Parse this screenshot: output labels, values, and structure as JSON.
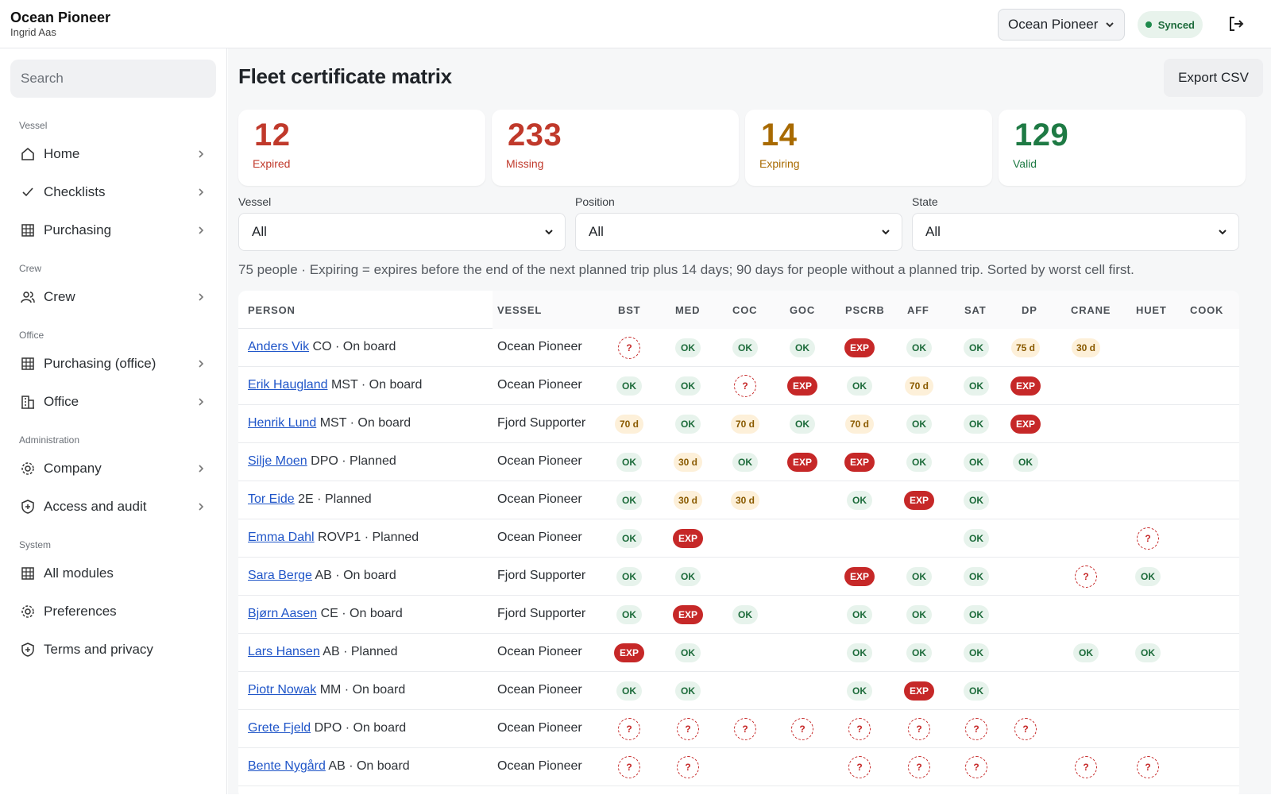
{
  "header": {
    "app_title": "Ocean Pioneer",
    "user_name": "Ingrid Aas",
    "vessel_selector": "Ocean Pioneer",
    "sync_status": "Synced",
    "colors": {
      "sync": "#1f8a4c"
    }
  },
  "sidebar": {
    "search_placeholder": "Search",
    "sections": [
      {
        "label": "Vessel",
        "items": [
          {
            "label": "Home",
            "icon": "home-icon"
          },
          {
            "label": "Checklists",
            "icon": "check-icon"
          },
          {
            "label": "Purchasing",
            "icon": "grid-icon"
          }
        ]
      },
      {
        "label": "Crew",
        "items": [
          {
            "label": "Crew",
            "icon": "people-icon"
          }
        ]
      },
      {
        "label": "Office",
        "items": [
          {
            "label": "Purchasing (office)",
            "icon": "grid-icon"
          },
          {
            "label": "Office",
            "icon": "building-icon"
          }
        ]
      },
      {
        "label": "Administration",
        "items": [
          {
            "label": "Company",
            "icon": "gear-icon"
          },
          {
            "label": "Access and audit",
            "icon": "shield-icon"
          }
        ]
      },
      {
        "label": "System",
        "items": [
          {
            "label": "All modules",
            "icon": "grid-icon"
          },
          {
            "label": "Preferences",
            "icon": "gear-icon"
          },
          {
            "label": "Terms and privacy",
            "icon": "shield-icon"
          }
        ]
      }
    ]
  },
  "main": {
    "title": "Fleet certificate matrix",
    "export_label": "Export CSV",
    "stats": [
      {
        "value": "12",
        "label": "Expired",
        "color": "#c0392b"
      },
      {
        "value": "233",
        "label": "Missing",
        "color": "#c0392b"
      },
      {
        "value": "14",
        "label": "Expiring",
        "color": "#a86a00"
      },
      {
        "value": "129",
        "label": "Valid",
        "color": "#1e7a44"
      }
    ],
    "filters": [
      {
        "label": "Vessel",
        "value": "All"
      },
      {
        "label": "Position",
        "value": "All"
      },
      {
        "label": "State",
        "value": "All"
      }
    ],
    "note": "75 people · Expiring = expires before the end of the next planned trip plus 14 days; 90 days for people without a planned trip. Sorted by worst cell first.",
    "table": {
      "headers": [
        "PERSON",
        "VESSEL",
        "BST",
        "MED",
        "COC",
        "GOC",
        "PSCRB",
        "AFF",
        "SAT",
        "DP",
        "CRANE",
        "HUET",
        "COOK"
      ],
      "rows": [
        {
          "name": "Anders Vik",
          "meta": "CO · On board",
          "vessel": "Ocean Pioneer",
          "cells": [
            "?",
            "OK",
            "OK",
            "OK",
            "EXP",
            "OK",
            "OK",
            "75 d",
            "30 d",
            "",
            ""
          ]
        },
        {
          "name": "Erik Haugland",
          "meta": "MST · On board",
          "vessel": "Ocean Pioneer",
          "cells": [
            "OK",
            "OK",
            "?",
            "EXP",
            "OK",
            "70 d",
            "OK",
            "EXP",
            "",
            "",
            ""
          ]
        },
        {
          "name": "Henrik Lund",
          "meta": "MST · On board",
          "vessel": "Fjord Supporter",
          "cells": [
            "70 d",
            "OK",
            "70 d",
            "OK",
            "70 d",
            "OK",
            "OK",
            "EXP",
            "",
            "",
            ""
          ]
        },
        {
          "name": "Silje Moen",
          "meta": "DPO · Planned",
          "vessel": "Ocean Pioneer",
          "cells": [
            "OK",
            "30 d",
            "OK",
            "EXP",
            "EXP",
            "OK",
            "OK",
            "OK",
            "",
            "",
            ""
          ]
        },
        {
          "name": "Tor Eide",
          "meta": "2E · Planned",
          "vessel": "Ocean Pioneer",
          "cells": [
            "OK",
            "30 d",
            "30 d",
            "",
            "OK",
            "EXP",
            "OK",
            "",
            "",
            "",
            ""
          ]
        },
        {
          "name": "Emma Dahl",
          "meta": "ROVP1 · Planned",
          "vessel": "Ocean Pioneer",
          "cells": [
            "OK",
            "EXP",
            "",
            "",
            "",
            "",
            "OK",
            "",
            "",
            "?",
            ""
          ]
        },
        {
          "name": "Sara Berge",
          "meta": "AB · On board",
          "vessel": "Fjord Supporter",
          "cells": [
            "OK",
            "OK",
            "",
            "",
            "EXP",
            "OK",
            "OK",
            "",
            "?",
            "OK",
            ""
          ]
        },
        {
          "name": "Bjørn Aasen",
          "meta": "CE · On board",
          "vessel": "Fjord Supporter",
          "cells": [
            "OK",
            "EXP",
            "OK",
            "",
            "OK",
            "OK",
            "OK",
            "",
            "",
            "",
            ""
          ]
        },
        {
          "name": "Lars Hansen",
          "meta": "AB · Planned",
          "vessel": "Ocean Pioneer",
          "cells": [
            "EXP",
            "OK",
            "",
            "",
            "OK",
            "OK",
            "OK",
            "",
            "OK",
            "OK",
            ""
          ]
        },
        {
          "name": "Piotr Nowak",
          "meta": "MM · On board",
          "vessel": "Ocean Pioneer",
          "cells": [
            "OK",
            "OK",
            "",
            "",
            "OK",
            "EXP",
            "OK",
            "",
            "",
            "",
            ""
          ]
        },
        {
          "name": "Grete Fjeld",
          "meta": "DPO · On board",
          "vessel": "Ocean Pioneer",
          "cells": [
            "?",
            "?",
            "?",
            "?",
            "?",
            "?",
            "?",
            "?",
            "",
            "",
            ""
          ]
        },
        {
          "name": "Bente Nygård",
          "meta": "AB · On board",
          "vessel": "Ocean Pioneer",
          "cells": [
            "?",
            "?",
            "",
            "",
            "?",
            "?",
            "?",
            "",
            "?",
            "?",
            ""
          ]
        }
      ]
    }
  }
}
